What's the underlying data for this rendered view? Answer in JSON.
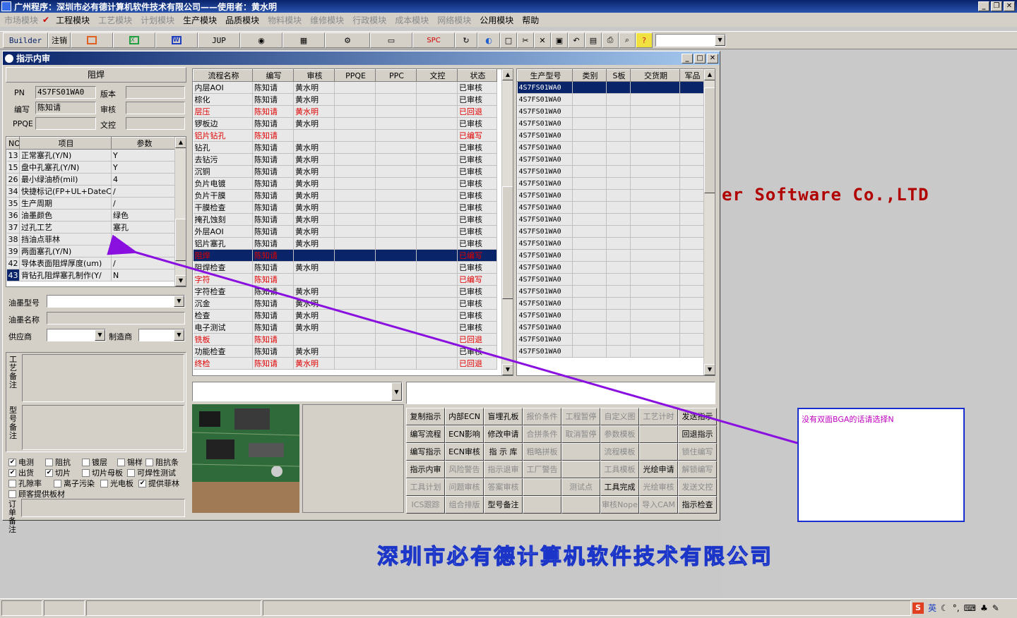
{
  "app": {
    "title": "广州程序：深圳市必有德计算机软件技术有限公司——使用者：黄水明"
  },
  "menu": {
    "items": [
      {
        "label": "市场模块",
        "enabled": false
      },
      {
        "label": "工程模块",
        "enabled": true
      },
      {
        "label": "工艺模块",
        "enabled": false
      },
      {
        "label": "计划模块",
        "enabled": false
      },
      {
        "label": "生产模块",
        "enabled": true
      },
      {
        "label": "品质模块",
        "enabled": true
      },
      {
        "label": "物料模块",
        "enabled": false
      },
      {
        "label": "维修模块",
        "enabled": false
      },
      {
        "label": "行政模块",
        "enabled": false
      },
      {
        "label": "成本模块",
        "enabled": false
      },
      {
        "label": "网络模块",
        "enabled": false
      },
      {
        "label": "公用模块",
        "enabled": true
      },
      {
        "label": "帮助",
        "enabled": true
      }
    ]
  },
  "toolbar": {
    "builder": "Builder",
    "logout": "注销",
    "jup": "JUP",
    "spc": "SPC"
  },
  "window": {
    "title": "指示内审"
  },
  "left": {
    "section": "阻焊",
    "pn_label": "PN",
    "pn_value": "4S7FS01WA0",
    "version_label": "版本",
    "author_label": "编写",
    "author_value": "陈知请",
    "review_label": "审核",
    "ppqe_label": "PPQE",
    "wenkong_label": "文控",
    "param_headers": [
      "NO",
      "项目",
      "参数"
    ],
    "params": [
      [
        "13",
        "正常塞孔(Y/N)",
        "Y"
      ],
      [
        "15",
        "盘中孔塞孔(Y/N)",
        "Y"
      ],
      [
        "26",
        "最小绿油桥(mil)",
        "4"
      ],
      [
        "34",
        "快捷标记(FP+UL+DateCo",
        "/"
      ],
      [
        "35",
        "生产周期",
        "/"
      ],
      [
        "36",
        "油墨颜色",
        "绿色"
      ],
      [
        "37",
        "过孔工艺",
        "塞孔"
      ],
      [
        "38",
        "挡油点菲林",
        "/"
      ],
      [
        "39",
        "两面塞孔(Y/N)",
        "Y"
      ],
      [
        "42",
        "导体表面阻焊厚度(um)",
        "/"
      ],
      [
        "43",
        "背钻孔阻焊塞孔制作(Y/",
        "N"
      ]
    ],
    "ink_type_label": "油墨型号",
    "ink_name_label": "油墨名称",
    "supplier_label": "供应商",
    "maker_label": "制造商",
    "craft_note_label": "工艺备注",
    "model_note_label": "型号备注",
    "order_note_label": "订单备注",
    "checks": [
      {
        "label": "电测",
        "checked": true
      },
      {
        "label": "阻抗",
        "checked": false
      },
      {
        "label": "镀层",
        "checked": false
      },
      {
        "label": "锡样",
        "checked": false
      },
      {
        "label": "阻抗条",
        "checked": false
      },
      {
        "label": "出货",
        "checked": true
      },
      {
        "label": "切片",
        "checked": true
      },
      {
        "label": "切片母板",
        "checked": false
      },
      {
        "label": "可焊性测试",
        "checked": false
      },
      {
        "label": "孔隙率",
        "checked": false
      },
      {
        "label": "离子污染",
        "checked": false
      },
      {
        "label": "光电板",
        "checked": false
      },
      {
        "label": "提供菲林",
        "checked": true
      },
      {
        "label": "顾客提供板材",
        "checked": false
      }
    ]
  },
  "flow": {
    "headers": [
      "流程名称",
      "编写",
      "审核",
      "PPQE",
      "PPC",
      "文控",
      "状态"
    ],
    "rows": [
      [
        "内层AOI",
        "陈知请",
        "黄水明",
        "",
        "",
        "",
        "已审核",
        "n"
      ],
      [
        "棕化",
        "陈知请",
        "黄水明",
        "",
        "",
        "",
        "已审核",
        "n"
      ],
      [
        "层压",
        "陈知请",
        "黄水明",
        "",
        "",
        "",
        "已回退",
        "r"
      ],
      [
        "锣板边",
        "陈知请",
        "黄水明",
        "",
        "",
        "",
        "已审核",
        "n"
      ],
      [
        "铝片钻孔",
        "陈知请",
        "",
        "",
        "",
        "",
        "已编写",
        "r"
      ],
      [
        "钻孔",
        "陈知请",
        "黄水明",
        "",
        "",
        "",
        "已审核",
        "n"
      ],
      [
        "去钻污",
        "陈知请",
        "黄水明",
        "",
        "",
        "",
        "已审核",
        "n"
      ],
      [
        "沉铜",
        "陈知请",
        "黄水明",
        "",
        "",
        "",
        "已审核",
        "n"
      ],
      [
        "负片电镀",
        "陈知请",
        "黄水明",
        "",
        "",
        "",
        "已审核",
        "n"
      ],
      [
        "负片干膜",
        "陈知请",
        "黄水明",
        "",
        "",
        "",
        "已审核",
        "n"
      ],
      [
        "干膜检查",
        "陈知请",
        "黄水明",
        "",
        "",
        "",
        "已审核",
        "n"
      ],
      [
        "掩孔蚀刻",
        "陈知请",
        "黄水明",
        "",
        "",
        "",
        "已审核",
        "n"
      ],
      [
        "外层AOI",
        "陈知请",
        "黄水明",
        "",
        "",
        "",
        "已审核",
        "n"
      ],
      [
        "铝片塞孔",
        "陈知请",
        "黄水明",
        "",
        "",
        "",
        "已审核",
        "n"
      ],
      [
        "阻焊",
        "陈知请",
        "",
        "",
        "",
        "",
        "已编写",
        "s"
      ],
      [
        "阻焊检查",
        "陈知请",
        "黄水明",
        "",
        "",
        "",
        "已审核",
        "n"
      ],
      [
        "字符",
        "陈知请",
        "",
        "",
        "",
        "",
        "已编写",
        "r"
      ],
      [
        "字符检查",
        "陈知请",
        "黄水明",
        "",
        "",
        "",
        "已审核",
        "n"
      ],
      [
        "沉金",
        "陈知请",
        "黄水明",
        "",
        "",
        "",
        "已审核",
        "n"
      ],
      [
        "检查",
        "陈知请",
        "黄水明",
        "",
        "",
        "",
        "已审核",
        "n"
      ],
      [
        "电子测试",
        "陈知请",
        "黄水明",
        "",
        "",
        "",
        "已审核",
        "n"
      ],
      [
        "铣板",
        "陈知请",
        "",
        "",
        "",
        "",
        "已回退",
        "r"
      ],
      [
        "功能检查",
        "陈知请",
        "黄水明",
        "",
        "",
        "",
        "已审核",
        "n"
      ],
      [
        "终检",
        "陈知请",
        "黄水明",
        "",
        "",
        "",
        "已回退",
        "r"
      ]
    ]
  },
  "models": {
    "headers": [
      "生产型号",
      "类别",
      "S板",
      "交货期",
      "军品"
    ],
    "rows": [
      "4S7FS01WA0",
      "4S7FS01WA0",
      "4S7FS01WA0",
      "4S7FS01WA0",
      "4S7FS01WA0",
      "4S7FS01WA0",
      "4S7FS01WA0",
      "4S7FS01WA0",
      "4S7FS01WA0",
      "4S7FS01WA0",
      "4S7FS01WA0",
      "4S7FS01WA0",
      "4S7FS01WA0",
      "4S7FS01WA0",
      "4S7FS01WA0",
      "4S7FS01WA0",
      "4S7FS01WA0",
      "4S7FS01WA0",
      "4S7FS01WA0",
      "4S7FS01WA0",
      "4S7FS01WA0",
      "4S7FS01WA0",
      "4S7FS01WA0"
    ]
  },
  "actions": [
    [
      {
        "l": "复制指示",
        "e": true
      },
      {
        "l": "内部ECN",
        "e": true
      },
      {
        "l": "盲埋孔板",
        "e": true
      },
      {
        "l": "报价条件",
        "e": false
      },
      {
        "l": "工程暂停",
        "e": false
      },
      {
        "l": "自定义图",
        "e": false
      },
      {
        "l": "工艺计时",
        "e": false
      },
      {
        "l": "发送指示",
        "e": true
      }
    ],
    [
      {
        "l": "编写流程",
        "e": true
      },
      {
        "l": "ECN影响",
        "e": true
      },
      {
        "l": "修改申请",
        "e": true
      },
      {
        "l": "合拼条件",
        "e": false
      },
      {
        "l": "取消暂停",
        "e": false
      },
      {
        "l": "参数模板",
        "e": false
      },
      {
        "l": "",
        "e": false
      },
      {
        "l": "回退指示",
        "e": true
      }
    ],
    [
      {
        "l": "编写指示",
        "e": true
      },
      {
        "l": "ECN审核",
        "e": true
      },
      {
        "l": "指 示 库",
        "e": true
      },
      {
        "l": "粗略拼板",
        "e": false
      },
      {
        "l": "",
        "e": false
      },
      {
        "l": "流程模板",
        "e": false
      },
      {
        "l": "",
        "e": false
      },
      {
        "l": "锁住编写",
        "e": false
      }
    ],
    [
      {
        "l": "指示内审",
        "e": true
      },
      {
        "l": "风险警告",
        "e": false
      },
      {
        "l": "指示退审",
        "e": false
      },
      {
        "l": "工厂警告",
        "e": false
      },
      {
        "l": "",
        "e": false
      },
      {
        "l": "工具模板",
        "e": false
      },
      {
        "l": "光绘申请",
        "e": true
      },
      {
        "l": "解锁编写",
        "e": false
      }
    ],
    [
      {
        "l": "工具计划",
        "e": false
      },
      {
        "l": "问题审核",
        "e": false
      },
      {
        "l": "答案审核",
        "e": false
      },
      {
        "l": "",
        "e": false
      },
      {
        "l": "测试点",
        "e": false
      },
      {
        "l": "工具完成",
        "e": true
      },
      {
        "l": "光绘审核",
        "e": false
      },
      {
        "l": "发送文控",
        "e": false
      }
    ],
    [
      {
        "l": "ICS跟踪",
        "e": false
      },
      {
        "l": "组合排版",
        "e": false
      },
      {
        "l": "型号备注",
        "e": true
      },
      {
        "l": "",
        "e": false
      },
      {
        "l": "",
        "e": false
      },
      {
        "l": "审核Nope",
        "e": false
      },
      {
        "l": "导入CAM",
        "e": false
      },
      {
        "l": "指示检查",
        "e": true
      }
    ]
  ],
  "background": {
    "software_text": "er Software Co.,LTD",
    "company": "深圳市必有德计算机软件技术有限公司"
  },
  "annotation": {
    "text": "没有双面BGA的话请选择N"
  },
  "tray": {
    "ime": "英"
  }
}
